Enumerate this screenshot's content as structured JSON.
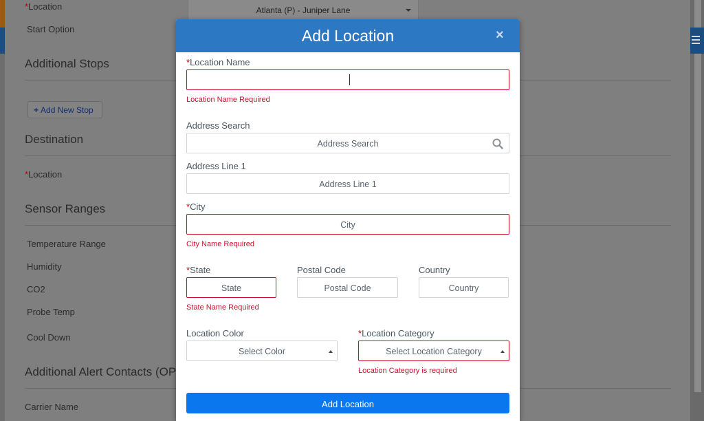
{
  "background": {
    "start_location": {
      "label": "Location",
      "value": "Atlanta (P) - Juniper Lane"
    },
    "start_option_label": "Start Option",
    "additional_stops_heading": "Additional Stops",
    "add_stop_button": "Add New Stop",
    "destination_heading": "Destination",
    "destination_location_label": "Location",
    "sensor_ranges_heading": "Sensor Ranges",
    "sensor_items": [
      "Temperature Range",
      "Humidity",
      "CO2",
      "Probe Temp",
      "Cool Down"
    ],
    "alert_contacts_heading": "Additional Alert Contacts (OPT",
    "carrier_name_label": "Carrier Name"
  },
  "modal": {
    "title": "Add Location",
    "close_glyph": "×",
    "location_name": {
      "label": "Location Name",
      "value": "",
      "error": "Location Name Required"
    },
    "address_search": {
      "label": "Address Search",
      "placeholder": "Address Search"
    },
    "address_line1": {
      "label": "Address Line 1",
      "placeholder": "Address Line 1"
    },
    "city": {
      "label": "City",
      "placeholder": "City",
      "error": "City Name Required"
    },
    "state": {
      "label": "State",
      "placeholder": "State",
      "error": "State Name Required"
    },
    "postal_code": {
      "label": "Postal Code",
      "placeholder": "Postal Code"
    },
    "country": {
      "label": "Country",
      "placeholder": "Country"
    },
    "location_color": {
      "label": "Location Color",
      "selected": "Select Color"
    },
    "location_category": {
      "label": "Location Category",
      "selected": "Select Location Category",
      "error": "Location Category is required"
    },
    "submit_label": "Add Location",
    "required_marker": "*"
  },
  "colors": {
    "header": "#2d78c2",
    "submit": "#0a77ee",
    "error": "#c8102e"
  }
}
